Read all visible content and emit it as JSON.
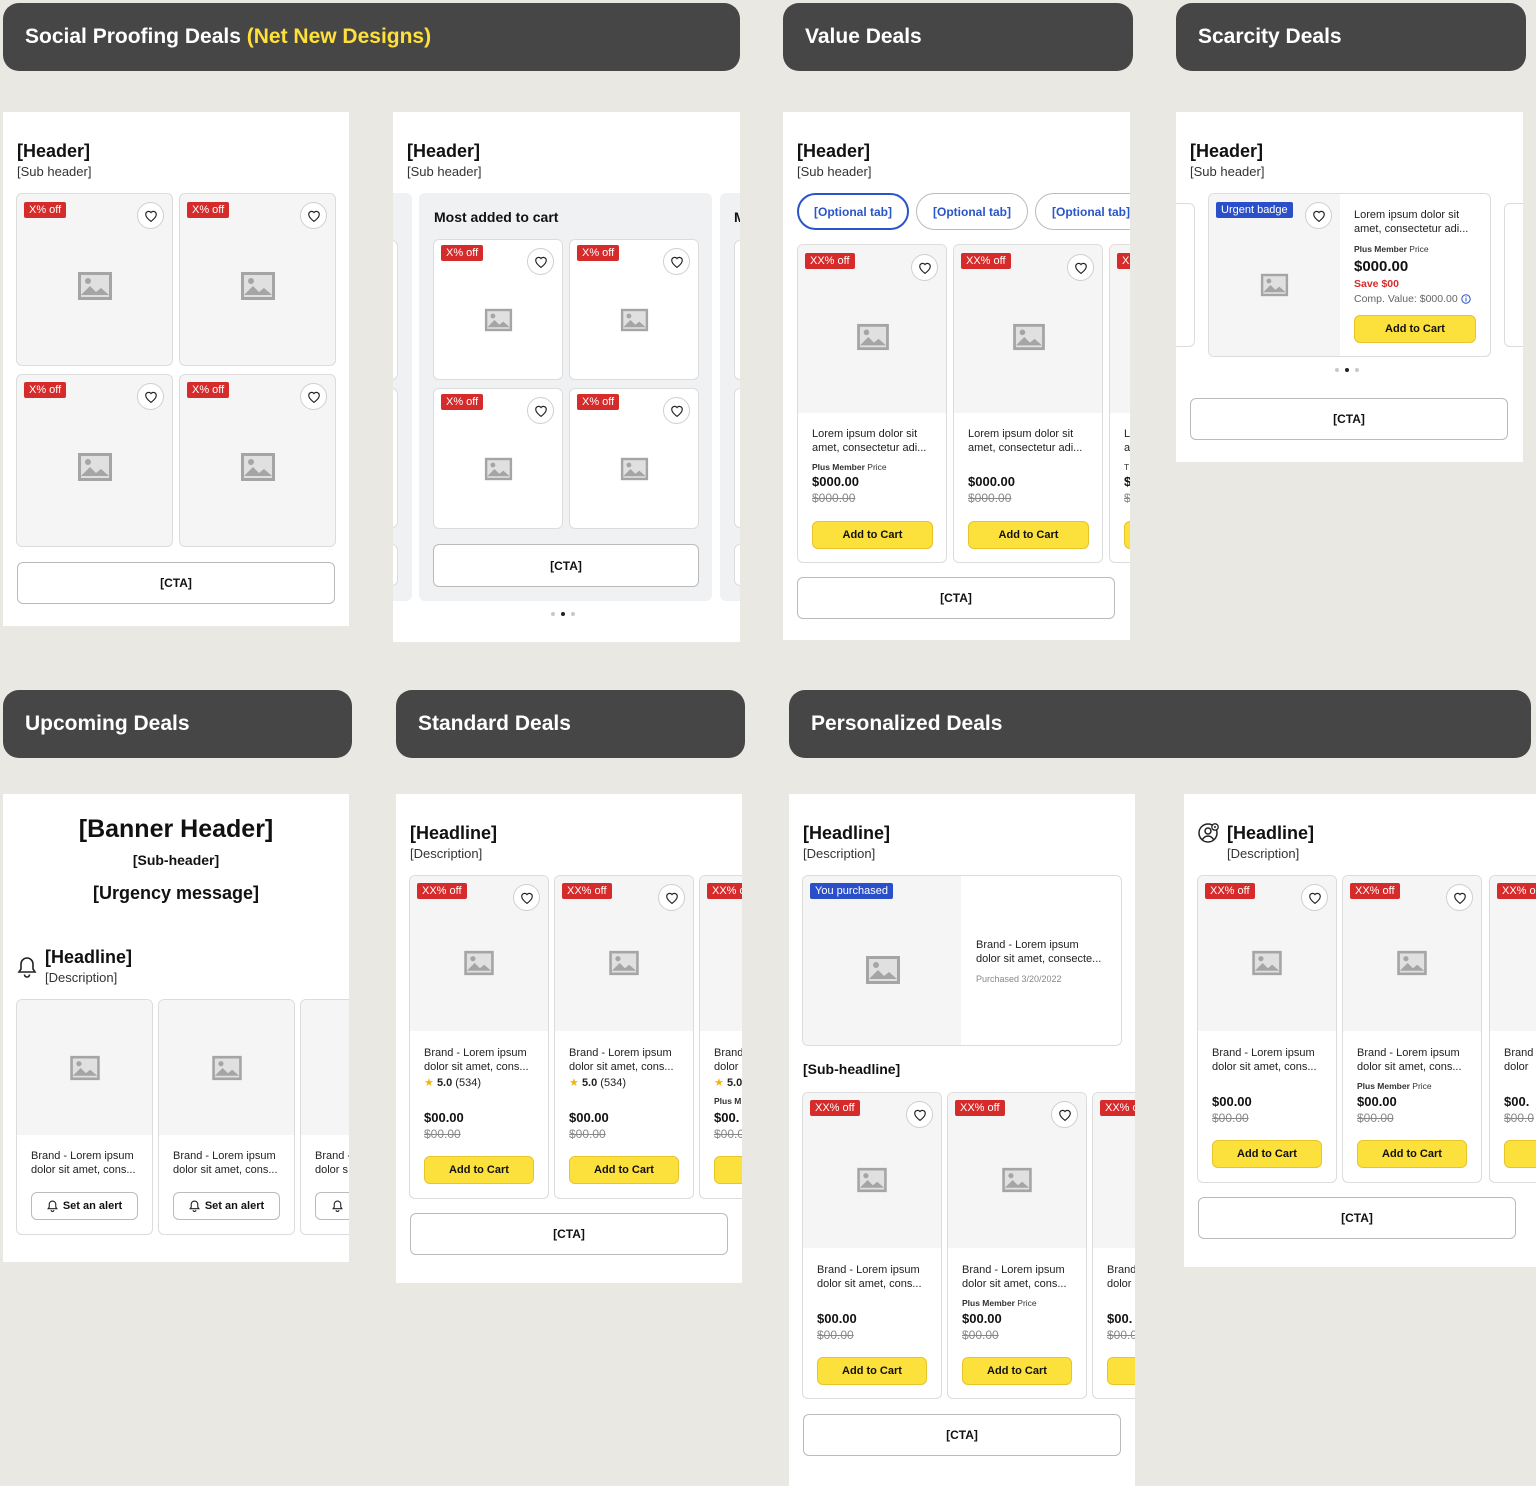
{
  "sections": {
    "social_proofing": {
      "title": "Social Proofing Deals",
      "highlight": "(Net New Designs)"
    },
    "value": {
      "title": "Value Deals"
    },
    "scarcity": {
      "title": "Scarcity Deals"
    },
    "upcoming": {
      "title": "Upcoming Deals"
    },
    "standard": {
      "title": "Standard Deals"
    },
    "personalized": {
      "title": "Personalized Deals"
    }
  },
  "common": {
    "header": "[Header]",
    "sub_header": "[Sub header]",
    "cta": "[CTA]",
    "headline": "[Headline]",
    "description": "[Description]",
    "add_to_cart": "Add to Cart",
    "x_off": "X% off",
    "xx_off": "XX% off",
    "xx_partial": "XX% o",
    "plus_member": "Plus Member",
    "price_word": "Price",
    "plus_partial": "Plus M",
    "lorem_full": "Lorem ipsum dolor sit amet, consectetur adi...",
    "brand_line1": "Brand - Lorem ipsum",
    "brand_line2": "dolor sit amet, cons...",
    "brand_partial1": "Brand",
    "brand_partial2": "dolor",
    "brand_dash_partial": "Brand -",
    "dolor_s": "dolor s",
    "price_000_000": "$000.00",
    "price_00_00": "$00.00",
    "price_partial": "$00.",
    "price_partial_was": "$00.0",
    "rating": "5.0",
    "rating_count": "(534)",
    "rating_partial": "5.0"
  },
  "social": {
    "most_added": "Most added to cart",
    "next_partial": "M"
  },
  "value_tabs": [
    "[Optional tab]",
    "[Optional tab]",
    "[Optional tab]"
  ],
  "value_partial": {
    "badge": "X",
    "l1": "L",
    "l2": "a",
    "l3": "T",
    "price": "$",
    "was": "$"
  },
  "scarcity": {
    "badge": "Urgent badge",
    "save": "Save $00",
    "comp": "Comp. Value: $000.00"
  },
  "upcoming": {
    "banner_header": "[Banner Header]",
    "sub_header": "[Sub-header]",
    "urgency": "[Urgency message]",
    "set_alert": "Set an alert"
  },
  "personalized": {
    "you_purchased": "You purchased",
    "purchased_line1": "Brand - Lorem ipsum",
    "purchased_line2": "dolor sit amet, consecte...",
    "purchased_date": "Purchased 3/20/2022",
    "sub_headline": "[Sub-headline]"
  },
  "colors": {
    "background": "#e9e8e3",
    "section_bar": "#464646",
    "highlight": "#ffe03a",
    "badge_red": "#d62b2b",
    "badge_blue": "#2a4fc9",
    "add_to_cart": "#fce03b",
    "tab_blue": "#2a55c8"
  },
  "icons": [
    "heart-icon",
    "image-placeholder-icon",
    "bell-icon",
    "star-icon",
    "info-icon",
    "user-gear-icon"
  ],
  "carousel": {
    "social_page": 2,
    "scarcity_page": 2,
    "pages": 3
  }
}
